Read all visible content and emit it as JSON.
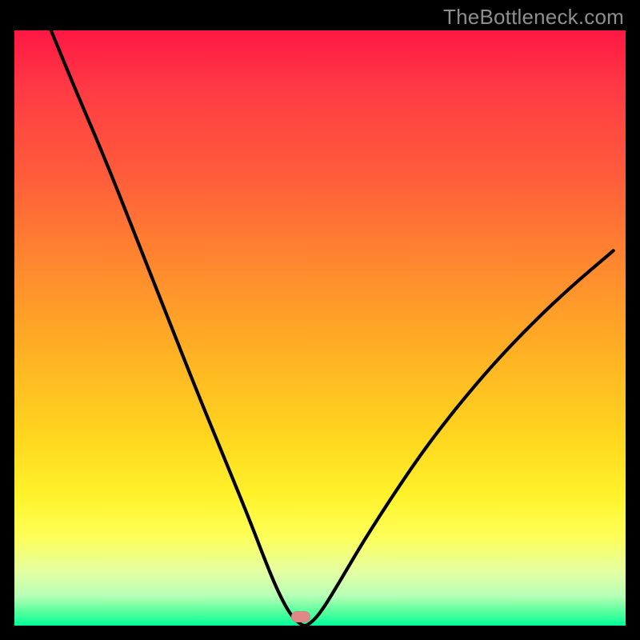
{
  "attribution": "TheBottleneck.com",
  "colors": {
    "frame": "#000000",
    "curve_stroke": "#000000",
    "marker_fill": "#e08888",
    "gradient_top": "#ff1744",
    "gradient_mid": "#ffd51f",
    "gradient_bottom": "#00ff99",
    "attribution_text": "#8e8e8e"
  },
  "marker": {
    "x_frac": 0.468,
    "y_frac": 0.985
  },
  "chart_data": {
    "type": "line",
    "title": "",
    "xlabel": "",
    "ylabel": "",
    "xlim": [
      0,
      100
    ],
    "ylim": [
      0,
      100
    ],
    "notes": "V-shaped bottleneck curve. y ≈ 100 means worst (red), y ≈ 0 means ideal (green). Minimum near x ≈ 47.",
    "series": [
      {
        "name": "bottleneck-curve",
        "x": [
          6,
          10,
          15,
          20,
          25,
          30,
          34,
          38,
          41,
          43,
          45,
          47,
          48,
          50,
          53,
          57,
          62,
          68,
          75,
          82,
          90,
          98
        ],
        "y": [
          100,
          90,
          78,
          65,
          52,
          39,
          29,
          19,
          11,
          6,
          2,
          0,
          0,
          2,
          7,
          14,
          22,
          31,
          40,
          48,
          56,
          63
        ]
      }
    ],
    "marker_point": {
      "x": 47,
      "y": 0
    }
  }
}
